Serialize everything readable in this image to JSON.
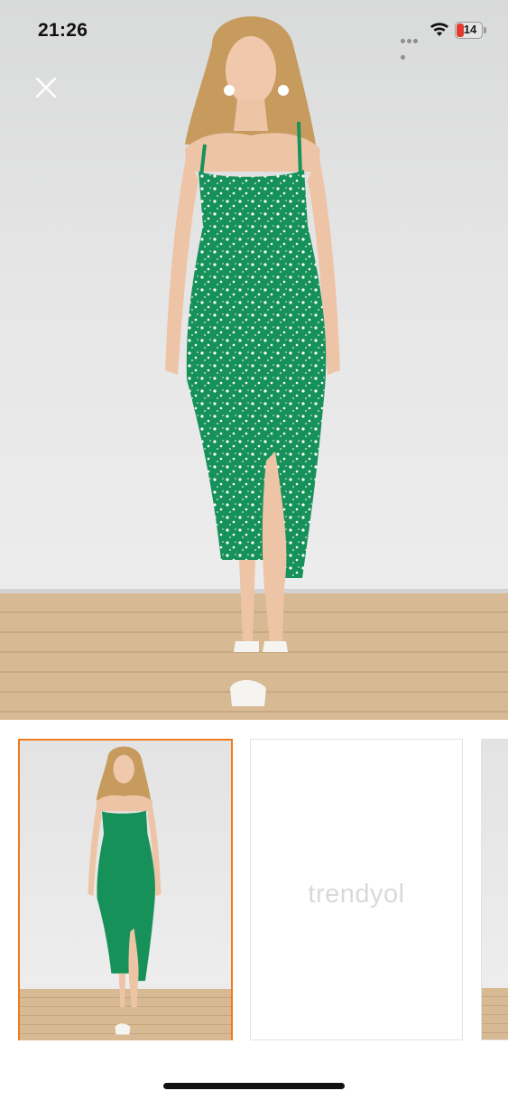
{
  "status_bar": {
    "time": "21:26",
    "battery_level": "14",
    "battery_color": "#e23a2c"
  },
  "viewer": {
    "close_icon": "close-icon",
    "main_image": "product-image-green-floral-midi-dress"
  },
  "thumbnails": [
    {
      "type": "product-image",
      "selected": true
    },
    {
      "type": "placeholder",
      "brand_text": "trendyol",
      "selected": false
    },
    {
      "type": "product-image",
      "selected": false
    }
  ],
  "colors": {
    "selection_accent": "#f27a1a",
    "dress_green": "#17915a"
  }
}
